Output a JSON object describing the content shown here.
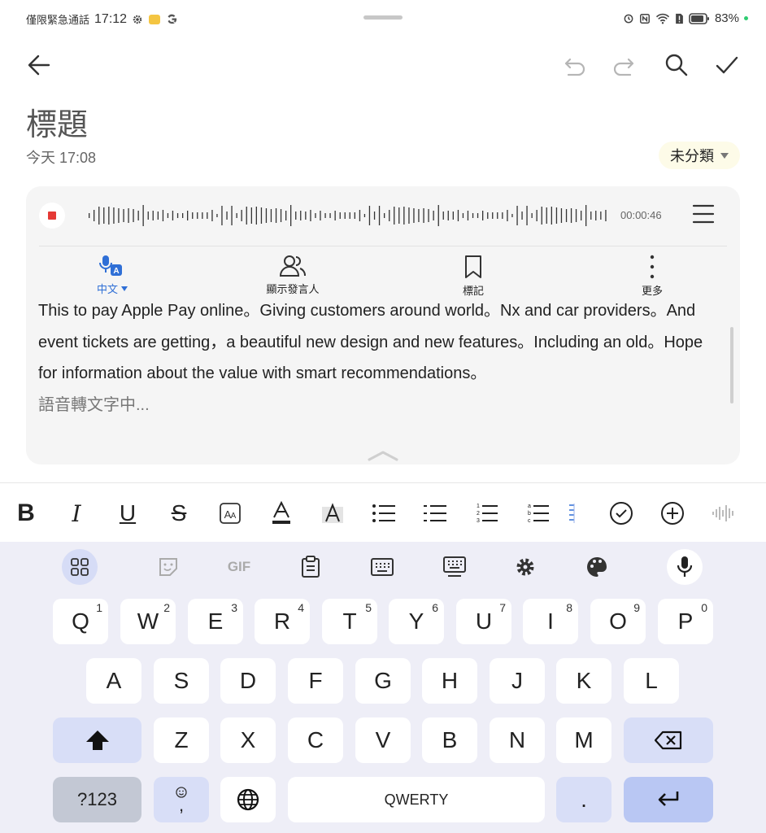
{
  "status_bar": {
    "emergency_text": "僅限緊急通話",
    "time": "17:12",
    "battery": "83%"
  },
  "note": {
    "title": "標題",
    "date": "今天 17:08",
    "category": "未分類"
  },
  "recording": {
    "elapsed": "00:00:46",
    "actions": [
      {
        "label": "中文"
      },
      {
        "label": "顯示發言人"
      },
      {
        "label": "標記"
      },
      {
        "label": "更多"
      }
    ],
    "transcript": "This to pay Apple Pay online。Giving customers around world。Nx and car providers。And event tickets are getting，a beautiful new design and new features。Including an old。Hope for information about the value with smart recommendations。",
    "status": "語音轉文字中..."
  },
  "format_toolbar": {
    "bold": "B",
    "italic": "I",
    "underline": "U",
    "strike": "S"
  },
  "keyboard": {
    "toolbar_text": {
      "gif": "GIF"
    },
    "row1": [
      {
        "k": "Q",
        "n": "1"
      },
      {
        "k": "W",
        "n": "2"
      },
      {
        "k": "E",
        "n": "3"
      },
      {
        "k": "R",
        "n": "4"
      },
      {
        "k": "T",
        "n": "5"
      },
      {
        "k": "Y",
        "n": "6"
      },
      {
        "k": "U",
        "n": "7"
      },
      {
        "k": "I",
        "n": "8"
      },
      {
        "k": "O",
        "n": "9"
      },
      {
        "k": "P",
        "n": "0"
      }
    ],
    "row2": [
      "A",
      "S",
      "D",
      "F",
      "G",
      "H",
      "J",
      "K",
      "L"
    ],
    "row3": [
      "Z",
      "X",
      "C",
      "V",
      "B",
      "N",
      "M"
    ],
    "symbols_key": "?123",
    "comma_key": ",",
    "space_label": "QWERTY",
    "period_key": "."
  }
}
